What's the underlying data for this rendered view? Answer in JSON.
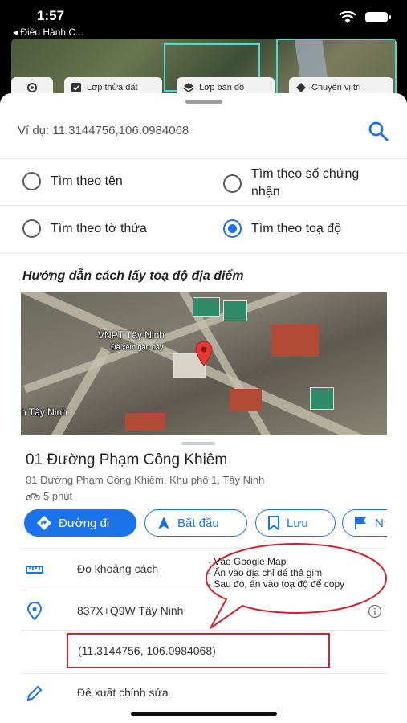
{
  "status_bar": {
    "time": "1:57",
    "back_label": "◂ Điều Hành C..."
  },
  "map_toolbar": {
    "chips": [
      {
        "label": "Lớp thửa đất",
        "icon": "checkbox-icon"
      },
      {
        "label": "Lớp bản đồ",
        "icon": "layers-icon"
      },
      {
        "label": "Chuyển vị trí",
        "icon": "location-icon"
      }
    ]
  },
  "search": {
    "placeholder": "Ví dụ: 11.3144756,106.0984068",
    "value": ""
  },
  "search_options": [
    {
      "label": "Tìm theo tên",
      "selected": false
    },
    {
      "label": "Tìm theo số chứng nhận",
      "selected": false
    },
    {
      "label": "Tìm theo tờ thửa",
      "selected": false
    },
    {
      "label": "Tìm theo toạ độ",
      "selected": true
    }
  ],
  "guide": {
    "title": "Hướng dẫn cách lấy toạ độ địa điểm",
    "map_labels": {
      "vnpt": "VNPT Tây Ninh",
      "seen": "Đã xem gần đây",
      "tay_ninh": "h Tây Ninh"
    },
    "place": {
      "name": "01 Đường Phạm Công Khiêm",
      "address": "01 Đường Phạm Công Khiêm, Khu phố 1, Tây Ninh",
      "travel_time": "5 phút"
    },
    "actions": [
      {
        "label": "Đường đi"
      },
      {
        "label": "Bắt đầu"
      },
      {
        "label": "Lưu"
      },
      {
        "label": "N"
      }
    ],
    "rows": {
      "measure": "Đo khoảng cách",
      "plus_code": "837X+Q9W Tây Ninh",
      "coordinates": "(11.3144756, 106.0984068)",
      "suggest_edit": "Đề xuất chỉnh sửa"
    },
    "callout": [
      "- Vào Google Map",
      "- Ấn vào địa chỉ để thả gim",
      "- Sau đó, ấn vào toạ độ để copy"
    ]
  },
  "colors": {
    "accent": "#1a73e8",
    "annotation": "#d0232f"
  }
}
